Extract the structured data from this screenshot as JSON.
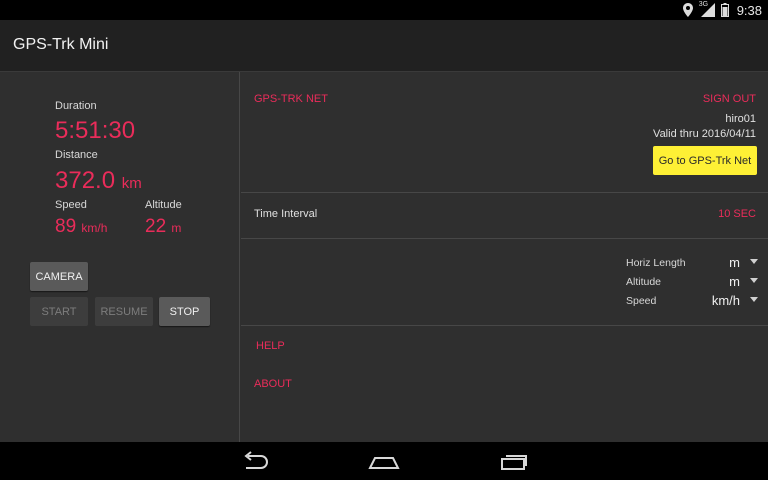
{
  "status_bar": {
    "icons": [
      "location-icon",
      "signal-3g-icon",
      "battery-icon"
    ],
    "network_label": "3G",
    "time": "9:38"
  },
  "action_bar": {
    "title": "GPS-Trk Mini"
  },
  "tracking": {
    "duration_label": "Duration",
    "duration_value": "5:51:30",
    "distance_label": "Distance",
    "distance_value": "372.0",
    "distance_unit": "km",
    "speed_label": "Speed",
    "speed_value": "89",
    "speed_unit": "km/h",
    "altitude_label": "Altitude",
    "altitude_value": "22",
    "altitude_unit": "m"
  },
  "controls": {
    "camera": "CAMERA",
    "start": "START",
    "resume": "RESUME",
    "stop": "STOP"
  },
  "net": {
    "title": "GPS-TRK NET",
    "sign_out": "SIGN OUT",
    "username": "hiro01",
    "valid_thru": "Valid thru 2016/04/11",
    "go_button": "Go to GPS-Trk Net"
  },
  "interval": {
    "label": "Time Interval",
    "value": "10 SEC"
  },
  "units": [
    {
      "name": "Horiz Length",
      "value": "m"
    },
    {
      "name": "Altitude",
      "value": "m"
    },
    {
      "name": "Speed",
      "value": "km/h"
    }
  ],
  "menu": {
    "help": "HELP",
    "about": "ABOUT"
  },
  "nav_bar": {
    "icons": [
      "back-icon",
      "home-icon",
      "recents-icon"
    ]
  },
  "colors": {
    "accent": "#ea2c5a",
    "highlight_button": "#fef035",
    "background": "#2f2f2f",
    "action_bar": "#212121"
  }
}
